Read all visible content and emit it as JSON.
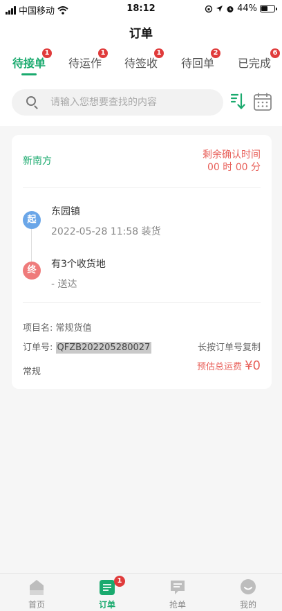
{
  "status_bar": {
    "carrier": "中国移动",
    "time": "18:12",
    "battery": "44%"
  },
  "header": {
    "title": "订单"
  },
  "tabs": [
    {
      "label": "待接单",
      "badge": "1"
    },
    {
      "label": "待运作",
      "badge": "1"
    },
    {
      "label": "待签收",
      "badge": "1"
    },
    {
      "label": "待回单",
      "badge": "2"
    },
    {
      "label": "已完成",
      "badge": "6"
    }
  ],
  "search": {
    "placeholder": "请输入您想要查找的内容"
  },
  "order": {
    "company": "新南方",
    "remain_label": "剩余确认时间",
    "remain_time": "00 时 00 分",
    "start_badge": "起",
    "start_place": "东园镇",
    "start_time": "2022-05-28 11:58 装货",
    "end_badge": "终",
    "end_place": "有3个收货地",
    "end_desc": "- 送达",
    "project_label": "项目名:",
    "project_value": "常规货值",
    "order_no_label": "订单号:",
    "order_no": "QFZB202205280027",
    "copy_hint": "长按订单号复制",
    "type": "常规",
    "fee_label": "预估总运费",
    "fee_amount": "¥0"
  },
  "bottom_nav": [
    {
      "label": "首页"
    },
    {
      "label": "订单",
      "badge": "1"
    },
    {
      "label": "抢单"
    },
    {
      "label": "我的"
    }
  ],
  "colors": {
    "accent": "#1aaa6e",
    "alert": "#e8605a",
    "badge": "#e03b3b",
    "start_dot": "#6aa6e8",
    "end_dot": "#ef7b7b"
  }
}
